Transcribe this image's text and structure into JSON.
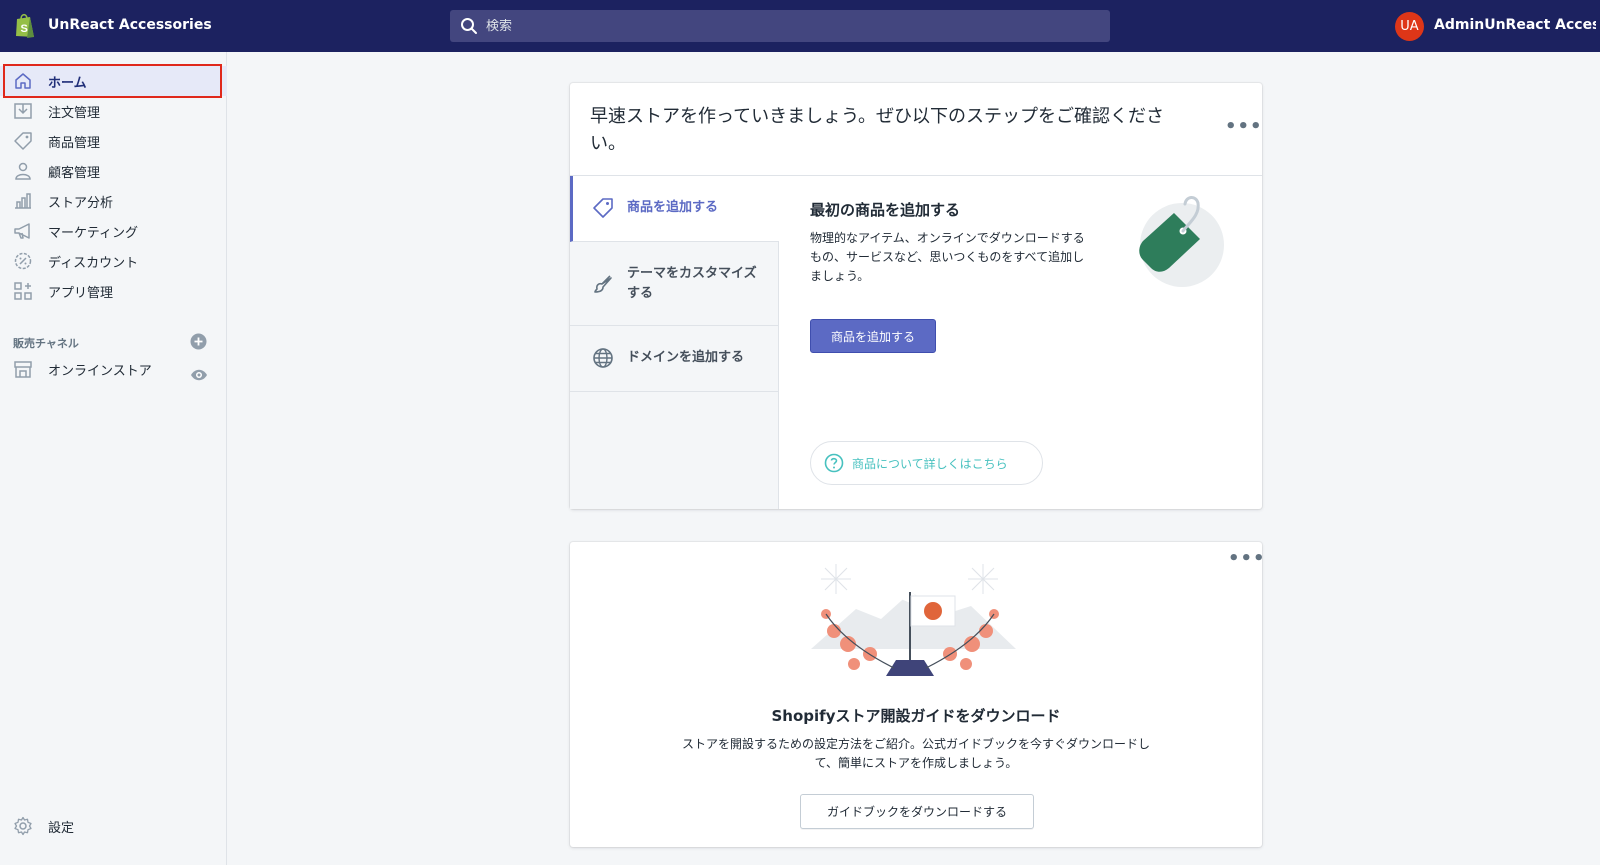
{
  "topbar": {
    "store_name": "UnReact Accessories",
    "search_placeholder": "検索",
    "avatar_initials": "UA",
    "user_name": "AdminUnReact Acces..."
  },
  "sidebar": {
    "items": [
      {
        "label": "ホーム",
        "icon": "home-icon",
        "active": true
      },
      {
        "label": "注文管理",
        "icon": "orders-icon"
      },
      {
        "label": "商品管理",
        "icon": "tag-icon"
      },
      {
        "label": "顧客管理",
        "icon": "customer-icon"
      },
      {
        "label": "ストア分析",
        "icon": "analytics-icon"
      },
      {
        "label": "マーケティング",
        "icon": "megaphone-icon"
      },
      {
        "label": "ディスカウント",
        "icon": "discount-icon"
      },
      {
        "label": "アプリ管理",
        "icon": "apps-icon"
      }
    ],
    "channels_title": "販売チャネル",
    "channel_item": "オンラインストア",
    "settings": "設定"
  },
  "setup_card": {
    "title": "早速ストアを作っていきましょう。ぜひ以下のステップをご確認ください。",
    "steps": [
      {
        "label": "商品を追加する",
        "icon": "tag-icon",
        "active": true
      },
      {
        "label": "テーマをカスタマイズする",
        "icon": "brush-icon"
      },
      {
        "label": "ドメインを追加する",
        "icon": "globe-icon"
      }
    ],
    "content_title": "最初の商品を追加する",
    "content_desc": "物理的なアイテム、オンラインでダウンロードするもの、サービスなど、思いつくものをすべて追加しましょう。",
    "primary_button": "商品を追加する",
    "learn_more": "商品について詳しくはこちら"
  },
  "guide_card": {
    "title": "Shopifyストア開設ガイドをダウンロード",
    "desc": "ストアを開設するための設定方法をご紹介。公式ガイドブックを今すぐダウンロードして、簡単にストアを作成しましょう。",
    "button": "ガイドブックをダウンロードする"
  },
  "colors": {
    "topbar": "#1c2260",
    "accent": "#5c6ac4",
    "highlight": "#e0281b",
    "tag_green": "#2e7d5b"
  }
}
